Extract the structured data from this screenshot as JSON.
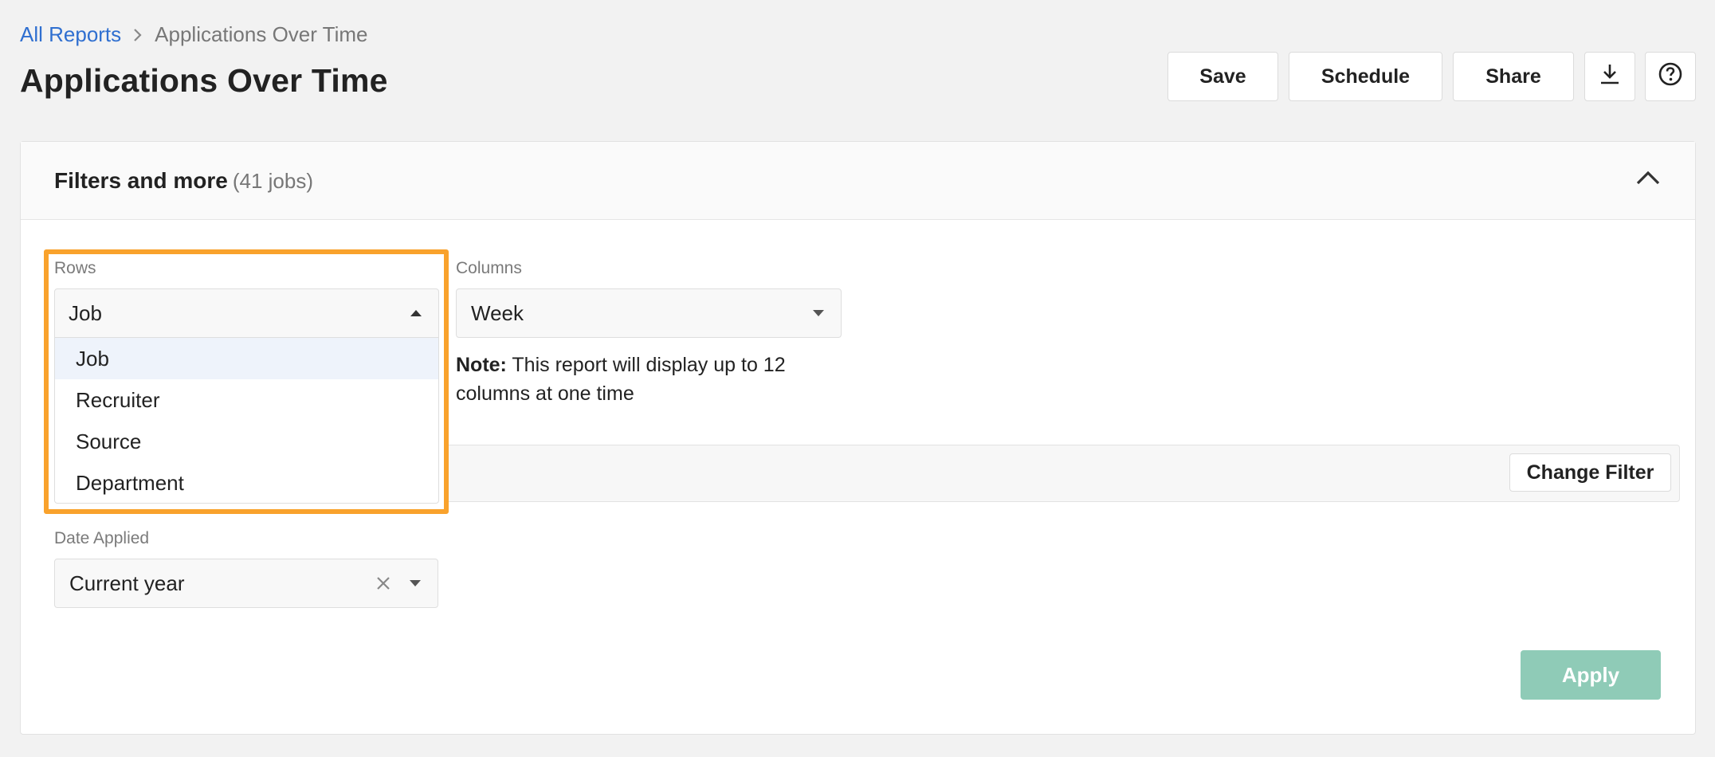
{
  "breadcrumb": {
    "root_label": "All Reports",
    "current_label": "Applications Over Time"
  },
  "page": {
    "title": "Applications Over Time"
  },
  "toolbar": {
    "save_label": "Save",
    "schedule_label": "Schedule",
    "share_label": "Share",
    "download_icon": "download-icon",
    "help_icon": "question-circle-icon"
  },
  "filters": {
    "title": "Filters and more",
    "count": "(41 jobs)",
    "collapse_icon": "chevron-up-icon",
    "rows": {
      "label": "Rows",
      "value": "Job",
      "options": [
        "Job",
        "Recruiter",
        "Source",
        "Department"
      ],
      "highlighted_option": "Job"
    },
    "columns": {
      "label": "Columns",
      "value": "Week"
    },
    "note": {
      "prefix": "Note:",
      "text": "This report will display up to 12 columns at one time"
    },
    "change_filter_label": "Change Filter",
    "date_applied": {
      "label": "Date Applied",
      "value": "Current year",
      "clear_icon": "close-icon"
    },
    "apply_label": "Apply"
  },
  "colors": {
    "link": "#2f6fd0",
    "highlight": "#f9a22c",
    "apply_button": "#8fcbb7",
    "active_option": "#eef3fb"
  }
}
